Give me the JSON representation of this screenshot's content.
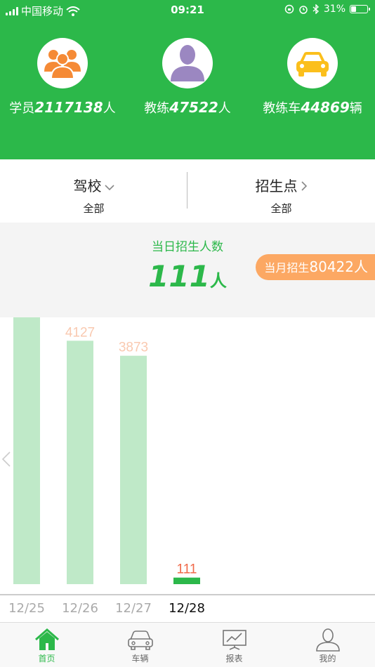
{
  "status_bar": {
    "carrier": "中国移动",
    "time": "09:21",
    "battery": "31%",
    "battery_level": 0.31
  },
  "header": {
    "stats": [
      {
        "prefix": "学员",
        "value": "2117138",
        "suffix": "人",
        "icon": "students-icon"
      },
      {
        "prefix": "教练",
        "value": "47522",
        "suffix": "人",
        "icon": "coach-icon"
      },
      {
        "prefix": "教练车",
        "value": "44869",
        "suffix": "辆",
        "icon": "car-icon"
      }
    ]
  },
  "filters": {
    "school": {
      "title": "驾校",
      "value": "全部"
    },
    "point": {
      "title": "招生点",
      "value": "全部"
    }
  },
  "today": {
    "label": "当日招生人数",
    "value": "111",
    "unit": "人",
    "month_label": "当月招生",
    "month_value": "80422",
    "month_unit": "人"
  },
  "colors": {
    "brand": "#2cb84a",
    "bar_light": "#bfe9c8",
    "label_light": "#f9c9b0",
    "label_active": "#f06a4a",
    "pill": "#fca863"
  },
  "chart_data": {
    "type": "bar",
    "categories": [
      "12/25",
      "12/26",
      "12/27",
      "12/28"
    ],
    "values": [
      4618,
      4127,
      3873,
      111
    ],
    "active_index": 3,
    "ylim": [
      0,
      5000
    ]
  },
  "tabbar": {
    "items": [
      {
        "label": "首页",
        "icon": "home-icon",
        "active": true
      },
      {
        "label": "车辆",
        "icon": "vehicle-icon",
        "active": false
      },
      {
        "label": "报表",
        "icon": "report-icon",
        "active": false
      },
      {
        "label": "我的",
        "icon": "profile-icon",
        "active": false
      }
    ]
  }
}
